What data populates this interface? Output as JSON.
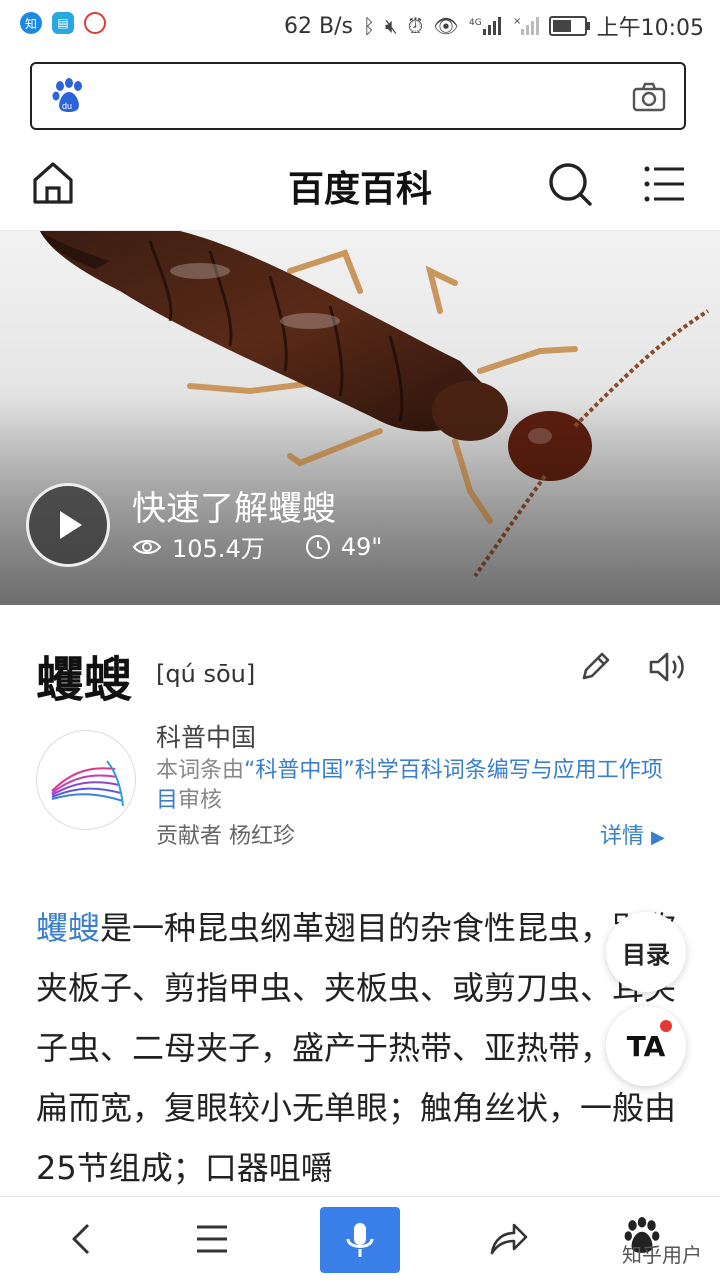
{
  "status_bar": {
    "net_speed": "62 B/s",
    "time": "上午10:05",
    "app_icons": [
      "zhihu-icon",
      "book-icon",
      "browser-icon"
    ],
    "battery_level": 0.6
  },
  "search_bar": {
    "placeholder": ""
  },
  "header": {
    "title": "百度百科"
  },
  "video": {
    "title": "快速了解蠼螋",
    "views": "105.4万",
    "duration": "49\""
  },
  "entry": {
    "title": "蠼螋",
    "pinyin": "[qú sōu]",
    "org_name": "科普中国",
    "audit_prefix": "本词条由",
    "audit_link": "“科普中国”科学百科词条编写与应用工作项目",
    "audit_suffix": "审核",
    "contributor": "贡献者 杨红珍",
    "details_label": "详情"
  },
  "body": {
    "link_word": "蠼螋",
    "text": "是一种昆虫纲革翅目的杂食性昆虫，别称夹板子、剪指甲虫、夹板虫、或剪刀虫、耳夹子虫、二母夹子，盛产于热带、亚热带，头部扁而宽，复眼较小无单眼；触角丝状，一般由25节组成；口器咀嚼"
  },
  "floating": {
    "toc_label": "目录",
    "ta_label": "TA"
  },
  "watermark": "知乎用户",
  "colors": {
    "accent": "#3a7fcc",
    "mic": "#3a7fe8"
  }
}
